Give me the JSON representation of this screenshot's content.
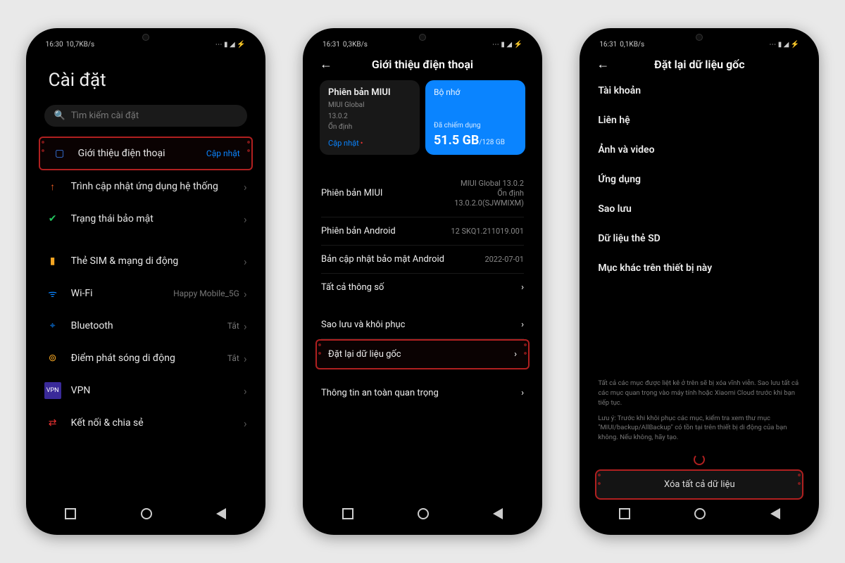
{
  "phone1": {
    "status": {
      "time": "16:30",
      "net": "10,7KB/s",
      "icons": "⋯ ▮ ◢ ⚡"
    },
    "title": "Cài đặt",
    "search_placeholder": "Tìm kiếm cài đặt",
    "rows": {
      "about": {
        "label": "Giới thiệu điện thoại",
        "trail": "Cập nhật"
      },
      "updater": {
        "label": "Trình cập nhật ứng dụng hệ thống"
      },
      "security": {
        "label": "Trạng thái bảo mật"
      },
      "sim": {
        "label": "Thẻ SIM & mạng di động"
      },
      "wifi": {
        "label": "Wi-Fi",
        "trail": "Happy Mobile_5G"
      },
      "bt": {
        "label": "Bluetooth",
        "trail": "Tắt"
      },
      "hotspot": {
        "label": "Điểm phát sóng di động",
        "trail": "Tắt"
      },
      "vpn": {
        "label": "VPN"
      },
      "share": {
        "label": "Kết nối & chia sẻ"
      }
    }
  },
  "phone2": {
    "status": {
      "time": "16:31",
      "net": "0,3KB/s",
      "icons": "⋯ ▮ ◢ ⚡"
    },
    "title": "Giới thiệu điện thoại",
    "card_miui": {
      "title": "Phiên bản MIUI",
      "line1": "MIUI Global",
      "line2": "13.0.2",
      "line3": "Ổn định",
      "link": "Cập nhật"
    },
    "card_storage": {
      "title": "Bộ nhớ",
      "sub": "Đã chiếm dụng",
      "used": "51.5 GB",
      "total": "/128 GB"
    },
    "specs": {
      "miui": {
        "k": "Phiên bản MIUI",
        "v": "MIUI Global 13.0.2\nỔn định\n13.0.2.0(SJWMIXM)"
      },
      "android": {
        "k": "Phiên bản Android",
        "v": "12 SKQ1.211019.001"
      },
      "patch": {
        "k": "Bản cập nhật bảo mật Android",
        "v": "2022-07-01"
      },
      "all": {
        "k": "Tất cả thông số"
      },
      "backup": {
        "k": "Sao lưu và khôi phục"
      },
      "reset": {
        "k": "Đặt lại dữ liệu gốc"
      },
      "safety": {
        "k": "Thông tin an toàn quan trọng"
      }
    }
  },
  "phone3": {
    "status": {
      "time": "16:31",
      "net": "0,1KB/s",
      "icons": "⋯ ▮ ◢ ⚡"
    },
    "title": "Đặt lại dữ liệu gốc",
    "items": {
      "accounts": "Tài khoản",
      "contacts": "Liên hệ",
      "photos": "Ảnh và video",
      "apps": "Ứng dụng",
      "backup": "Sao lưu",
      "sd": "Dữ liệu thẻ SD",
      "other": "Mục khác trên thiết bị này"
    },
    "warn1": "Tất cả các mục được liệt kê ở trên sẽ bị xóa vĩnh viễn. Sao lưu tất cả các mục quan trọng vào máy tính hoặc Xiaomi Cloud trước khi bạn tiếp tục.",
    "warn2": "Lưu ý: Trước khi khôi phục các mục, kiểm tra xem thư mục \"MIUI/backup/AllBackup\" có tồn tại trên thiết bị di động của bạn không. Nếu không, hãy tạo.",
    "erase": "Xóa tất cả dữ liệu"
  }
}
